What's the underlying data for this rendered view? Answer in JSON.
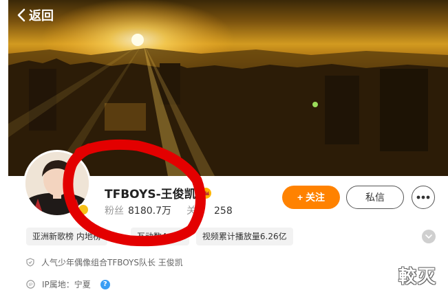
{
  "header": {
    "back_label": "返回"
  },
  "profile": {
    "name": "TFBOYS-王俊凯",
    "followers_label": "粉丝",
    "followers_value": "8180.7万",
    "following_label": "关",
    "following_value": "258"
  },
  "actions": {
    "follow_label": "+ 关注",
    "message_label": "私信"
  },
  "tags": [
    "亚洲新歌榜 内地榜",
    "互动数4.4万",
    "视频累计播放量6.26亿"
  ],
  "info": {
    "bio": "人气少年偶像组合TFBOYS队长 王俊凯",
    "ip_location": "IP属地：宁夏",
    "help_glyph": "?"
  },
  "watermark": "較灭",
  "icons": {
    "back": "chevron-left-icon",
    "shield": "shield-icon",
    "ip": "ip-location-icon",
    "more": "more-dots-icon",
    "expand": "chevron-down-icon",
    "crown": "crown-icon"
  },
  "colors": {
    "accent": "#ff8200",
    "annotation": "#e30000",
    "help": "#3b9ef4"
  }
}
